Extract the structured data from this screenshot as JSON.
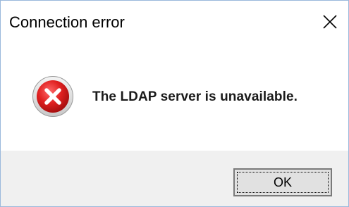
{
  "window": {
    "title": "Connection error",
    "close_icon": "close-icon"
  },
  "dialog": {
    "icon": "error-icon",
    "message": "The LDAP server is unavailable."
  },
  "buttons": {
    "ok_label": "OK"
  },
  "colors": {
    "error_red": "#e02020",
    "footer_bg": "#f0f0f0",
    "border": "#9ab8dc"
  }
}
